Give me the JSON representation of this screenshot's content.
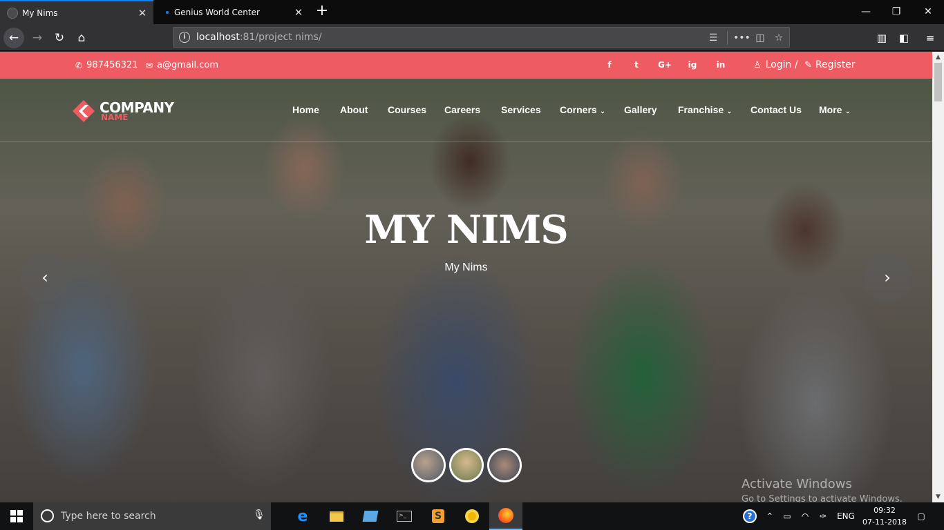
{
  "browser": {
    "tabs": [
      {
        "title": "My Nims",
        "active": true
      },
      {
        "title": "Genius World Center",
        "active": false
      }
    ],
    "url_host": "localhost",
    "url_rest": ":81/project nims/"
  },
  "site": {
    "topbar": {
      "phone": "987456321",
      "email": "a@gmail.com",
      "social": [
        "f",
        "t",
        "G+",
        "ig",
        "in"
      ],
      "login": "Login /",
      "register": "Register"
    },
    "logo": {
      "line1": "COMPANY",
      "line2": "NAME"
    },
    "menu": [
      "Home",
      "About",
      "Courses",
      "Careers",
      "Services",
      "Corners",
      "Gallery",
      "Franchise",
      "Contact Us",
      "More"
    ],
    "hero": {
      "title": "MY NIMS",
      "subtitle": "My Nims"
    },
    "carousel": {
      "prev": "‹",
      "next": "›"
    }
  },
  "overlay": {
    "activate_title": "Activate Windows",
    "activate_text": "Go to Settings to activate Windows."
  },
  "taskbar": {
    "search_placeholder": "Type here to search",
    "lang": "ENG",
    "time": "09:32",
    "date": "07-11-2018"
  },
  "colors": {
    "brand": "#ef5b62",
    "accent": "#0a84ff"
  }
}
